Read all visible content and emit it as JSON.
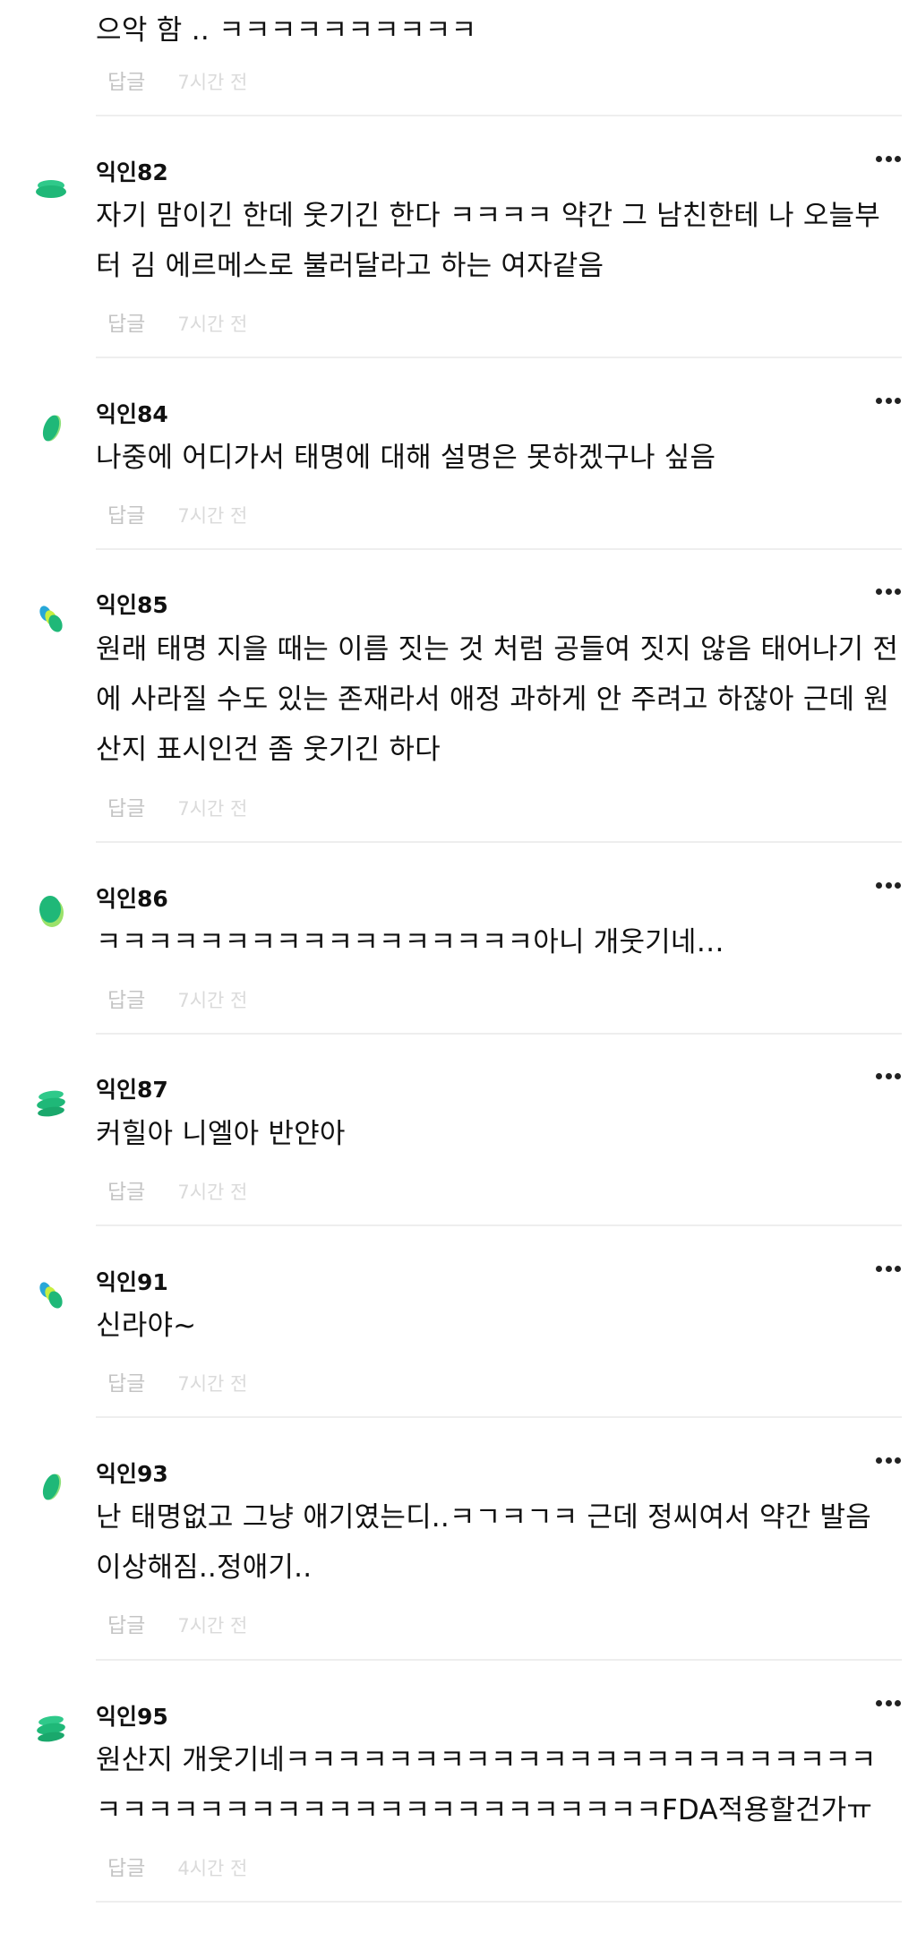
{
  "top_fragment": {
    "text": "으악 함 .. ㅋㅋㅋㅋㅋㅋㅋㅋㅋㅋ",
    "reply_label": "답글",
    "time": "7시간 전"
  },
  "colors": {
    "green": "#1fb878",
    "light_green": "#9be26a",
    "blue": "#27a7d8",
    "lime": "#c7ef3f"
  },
  "comments": [
    {
      "author": "익인82",
      "avatar": "stack-icon",
      "body": "자기 맘이긴 한데 웃기긴 한다 ㅋㅋㅋㅋ 약간 그 남친한테 나 오늘부터 김 에르메스로 불러달라고 하는 여자같음",
      "reply_label": "답글",
      "time": "7시간 전"
    },
    {
      "author": "익인84",
      "avatar": "leaf-icon",
      "body": "나중에 어디가서 태명에 대해 설명은 못하겠구나 싶음",
      "reply_label": "답글",
      "time": "7시간 전"
    },
    {
      "author": "익인85",
      "avatar": "pebbles-icon",
      "body": "원래 태명 지을 때는 이름 짓는 것 처럼 공들여 짓지 않음 태어나기 전에 사라질 수도 있는 존재라서 애정 과하게 안 주려고 하잖아 근데 원산지 표시인건 좀 웃기긴 하다",
      "reply_label": "답글",
      "time": "7시간 전"
    },
    {
      "author": "익인86",
      "avatar": "bean-icon",
      "body": "ㅋㅋㅋㅋㅋㅋㅋㅋㅋㅋㅋㅋㅋㅋㅋㅋㅋ아니 개웃기네…",
      "reply_label": "답글",
      "time": "7시간 전"
    },
    {
      "author": "익인87",
      "avatar": "stack3-icon",
      "body": "커힐아 니엘아 반얀아",
      "reply_label": "답글",
      "time": "7시간 전"
    },
    {
      "author": "익인91",
      "avatar": "pebbles-icon",
      "body": "신라야~",
      "reply_label": "답글",
      "time": "7시간 전"
    },
    {
      "author": "익인93",
      "avatar": "leaf-icon",
      "body": "난 태명없고 그냥 애기였는디..ㅋㄱㅋㄱㅋ 근데 정씨여서 약간 발음 이상해짐..정애기..",
      "reply_label": "답글",
      "time": "7시간 전"
    },
    {
      "author": "익인95",
      "avatar": "stack3-icon",
      "body": "원산지 개웃기네ㅋㅋㅋㅋㅋㅋㅋㅋㅋㅋㅋㅋㅋㅋㅋㅋㅋㅋㅋㅋㅋㅋㅋㅋㅋㅋㅋㅋㅋㅋㅋㅋㅋㅋㅋㅋㅋㅋㅋㅋㅋㅋㅋㅋㅋFDA적용할건가ㅠ",
      "reply_label": "답글",
      "time": "4시간 전"
    }
  ]
}
